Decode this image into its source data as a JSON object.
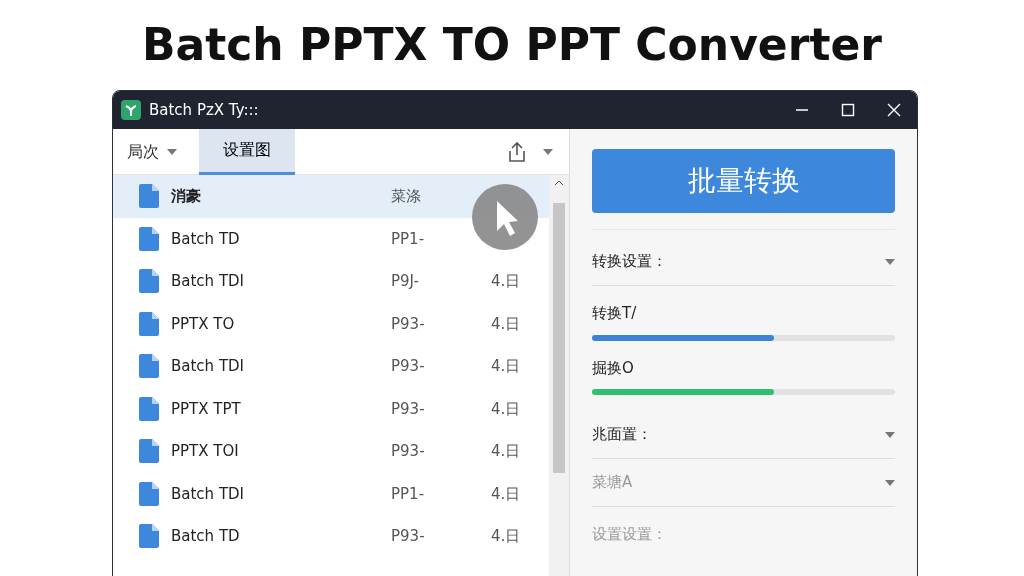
{
  "heading": "Batch PPTX TO PPT Converter",
  "window": {
    "title": "Batch PzX Ty:::"
  },
  "toolbar": {
    "menu": "局次",
    "tabs": [
      {
        "label": "设置图",
        "selected": true
      }
    ]
  },
  "file_list": {
    "rows": [
      {
        "name": "消豪",
        "column_2": "菜涤",
        "selected": true
      },
      {
        "name": "Batch TD",
        "column_2": "PP1-",
        "selected": false
      },
      {
        "name": "Batch TDI",
        "column_2": "P9J-",
        "column_3": "4.日",
        "selected": false
      },
      {
        "name": "PPTX TO",
        "column_2": "P93-",
        "column_3": "4.日",
        "selected": false
      },
      {
        "name": "Batch TDI",
        "column_2": "P93-",
        "column_3": "4.日",
        "selected": false
      },
      {
        "name": "PPTX TPT",
        "column_2": "P93-",
        "column_3": "4.日",
        "selected": false
      },
      {
        "name": "PPTX TOI",
        "column_2": "P93-",
        "column_3": "4.日",
        "selected": false
      },
      {
        "name": "Batch TDI",
        "column_2": "PP1-",
        "column_3": "4.日",
        "selected": false
      },
      {
        "name": "Batch TD",
        "column_2": "P93-",
        "column_3": "4.日",
        "selected": false
      }
    ]
  },
  "convert_button": "批量转换",
  "settings": [
    {
      "kind": "dropdown",
      "label": "转换设置：",
      "disabled": false
    },
    {
      "kind": "progress",
      "label": "转换T/",
      "level": 0.6,
      "color": "#3b82d8"
    },
    {
      "kind": "progress",
      "label": "掘换O",
      "level": 0.6,
      "color": "#2fbf71"
    },
    {
      "kind": "dropdown",
      "label": "兆面置：",
      "disabled": false
    },
    {
      "kind": "dropdown",
      "label": "菜塘A",
      "disabled": true
    },
    {
      "kind": "label",
      "label": "设置设置：",
      "disabled": true
    }
  ]
}
